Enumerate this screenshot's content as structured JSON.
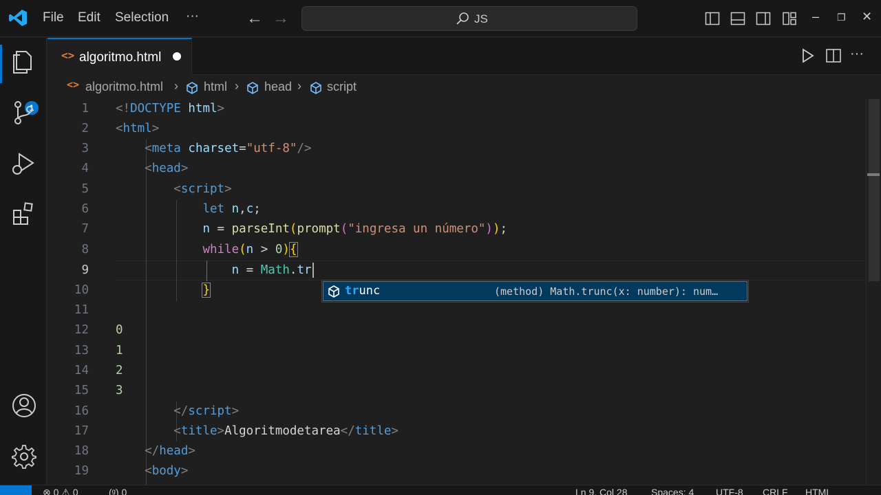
{
  "titlebar": {
    "menu": [
      "File",
      "Edit",
      "Selection",
      "···"
    ],
    "search_text": "JS"
  },
  "activity": {
    "explorer_badge": "1"
  },
  "tab": {
    "label": "algoritmo.html",
    "icon": "<>"
  },
  "breadcrumb": {
    "file": "algoritmo.html",
    "items": [
      "html",
      "head",
      "script"
    ]
  },
  "editor": {
    "current_line": 9,
    "line_numbers": [
      "1",
      "2",
      "3",
      "4",
      "5",
      "6",
      "7",
      "8",
      "9",
      "10",
      "11",
      "12",
      "13",
      "14",
      "15",
      "16",
      "17",
      "18",
      "19"
    ]
  },
  "suggestion": {
    "match": "tr",
    "rest": "unc",
    "detail": "(method) Math.trunc(x: number): num…"
  },
  "statusbar": {
    "left": "⊗ 0 ⚠ 0",
    "ports": "(ᵍ) 0",
    "position": "Ln 9, Col 28",
    "spaces": "Spaces: 4",
    "encoding": "UTF-8",
    "eol": "CRLF",
    "language": "HTML"
  },
  "colors": {
    "accent": "#0078d4",
    "editor_bg": "#1f1f1f",
    "chrome_bg": "#181818"
  }
}
